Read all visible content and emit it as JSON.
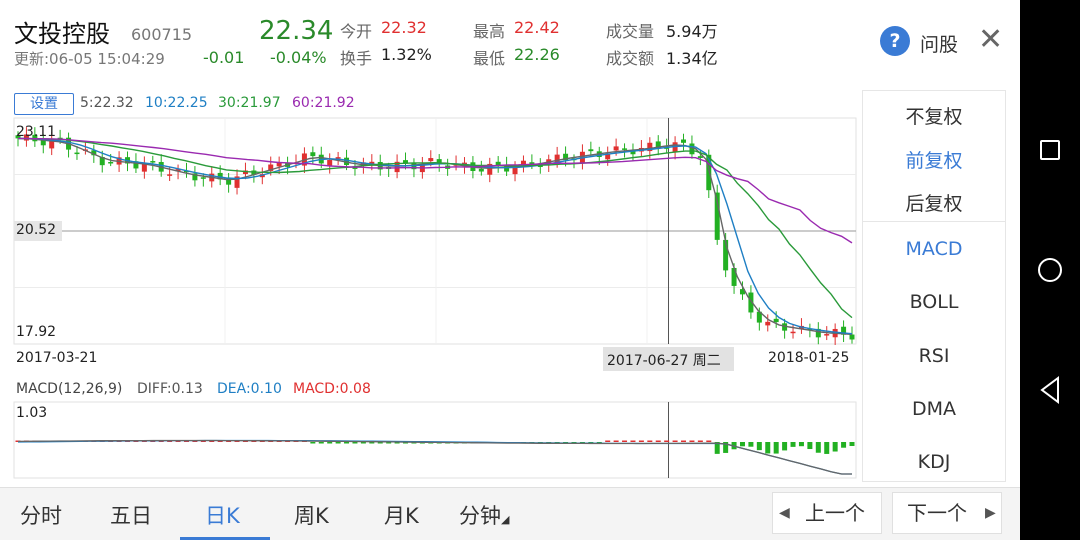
{
  "header": {
    "stock_name": "文投控股",
    "stock_code": "600715",
    "update_time": "更新:06-05 15:04:29",
    "change": "-0.01",
    "change_pct": "-0.04%",
    "price": "22.34",
    "open_label": "今开",
    "open_value": "22.32",
    "turnover_label": "换手",
    "turnover_value": "1.32%",
    "high_label": "最高",
    "high_value": "22.42",
    "low_label": "最低",
    "low_value": "22.26",
    "volume_label": "成交量",
    "volume_value": "5.94万",
    "amount_label": "成交额",
    "amount_value": "1.34亿",
    "ask_icon": "?",
    "ask_label": "问股",
    "close_icon": "✕"
  },
  "chart": {
    "settings_label": "设置",
    "ma5": "5:22.32",
    "ma10": "10:22.25",
    "ma30": "30:21.97",
    "ma60": "60:21.92",
    "price_top": "23.11",
    "price_mid": "20.52",
    "price_bottom": "17.92",
    "date_start": "2017-03-21",
    "date_cursor": "2017-06-27 周二",
    "date_end": "2018-01-25",
    "macd_title": "MACD(12,26,9)",
    "macd_diff": "DIFF:0.13",
    "macd_dea": "DEA:0.10",
    "macd_value": "MACD:0.08",
    "macd_top": "1.03"
  },
  "colors": {
    "up": "#e03030",
    "down": "#22b022",
    "ma5": "#666666",
    "ma10": "#1f7fc4",
    "ma30": "#2a9a3a",
    "ma60": "#9a2ab0",
    "accent": "#3a7bd5"
  },
  "side_panel": {
    "items": [
      "不复权",
      "前复权",
      "后复权",
      "MACD",
      "BOLL",
      "RSI",
      "DMA",
      "KDJ"
    ]
  },
  "tabs": {
    "items": [
      "分时",
      "五日",
      "日K",
      "周K",
      "月K",
      "分钟"
    ],
    "prev": "上一个",
    "next": "下一个"
  },
  "chart_data": {
    "type": "candlestick",
    "y_axis_labels": [
      "23.11",
      "20.52",
      "17.92"
    ],
    "ylim": [
      17.92,
      23.11
    ],
    "x_axis_labels": [
      "2017-03-21",
      "2017-06-27 周二",
      "2018-01-25"
    ],
    "moving_averages": [
      {
        "name": "5",
        "value": 22.32
      },
      {
        "name": "10",
        "value": 22.25
      },
      {
        "name": "30",
        "value": 21.97
      },
      {
        "name": "60",
        "value": 21.92
      }
    ],
    "macd": {
      "params": "(12,26,9)",
      "diff": 0.13,
      "dea": 0.1,
      "macd": 0.08,
      "top": 1.03
    }
  }
}
